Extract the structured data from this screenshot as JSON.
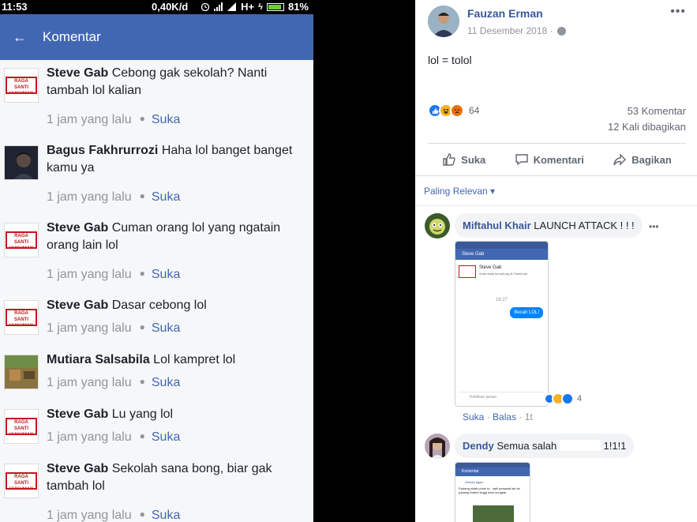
{
  "phone": {
    "status": {
      "time": "11:53",
      "speed": "0,40K/d",
      "network": "H+",
      "battery": "81%"
    },
    "appbar": {
      "back": "←",
      "title": "Komentar"
    },
    "comments": [
      {
        "name": "Steve Gab",
        "text": "Cebong gak sekolah? Nanti tambah lol kalian",
        "time": "1 jam yang lalu",
        "like": "Suka",
        "logo": "RAGA SANTI HUKUMAN"
      },
      {
        "name": "Bagus Fakhrurrozi",
        "text": "Haha lol banget banget kamu ya",
        "time": "1 jam yang lalu",
        "like": "Suka"
      },
      {
        "name": "Steve Gab",
        "text": "Cuman orang lol yang ngatain orang lain lol",
        "time": "1 jam yang lalu",
        "like": "Suka",
        "logo": "RAGA SANTI HUKUMAN"
      },
      {
        "name": "Steve Gab",
        "text": "Dasar cebong lol",
        "time": "1 jam yang lalu",
        "like": "Suka",
        "logo": "RAGA SANTI HUKUMAN"
      },
      {
        "name": "Mutiara Salsabila",
        "text": "Lol kampret lol",
        "time": "1 jam yang lalu",
        "like": "Suka"
      },
      {
        "name": "Steve Gab",
        "text": "Lu yang lol",
        "time": "1 jam yang lalu",
        "like": "Suka",
        "logo": "RAGA SANTI HUKUMAN"
      },
      {
        "name": "Steve Gab",
        "text": "Sekolah sana bong, biar gak tambah lol",
        "time": "1 jam yang lalu",
        "like": "Suka",
        "logo": "RAGA SANTI HUKUMAN"
      }
    ]
  },
  "fb": {
    "author": "Fauzan Erman",
    "date": "11 Desember 2018 ·",
    "more": "•••",
    "body": "lol = tolol",
    "reaction_count": "64",
    "comments_count": "53 Komentar",
    "shares_count": "12 Kali dibagikan",
    "actions": {
      "like": "Suka",
      "comment": "Komentari",
      "share": "Bagikan"
    },
    "filter": "Paling Relevan ▾",
    "comments": [
      {
        "name": "Miftahul Khair",
        "text": "LAUNCH ATTACK ! ! !",
        "more": "•••",
        "shot": {
          "header": "Steve Gab",
          "line1": "Steve Gab",
          "line2": "Anda tidak terhubung di Facebook",
          "time": "16:27",
          "bubble": "Becah LOL!",
          "input": "Ketikkan pesan"
        },
        "rx_count": "4",
        "foot": {
          "like": "Suka",
          "sep": "·",
          "reply": "Balas",
          "age": "· 1t"
        }
      },
      {
        "name": "Dendy",
        "text": "Semua salah",
        "tail": "1!1!1",
        "shot": {
          "header": "Komentar",
          "name": "Ahmad Ilgam",
          "line1": "Padang sidak puluh bi.. naik pesawat lah ke padang buken tinggi baru sungkar"
        }
      }
    ]
  }
}
